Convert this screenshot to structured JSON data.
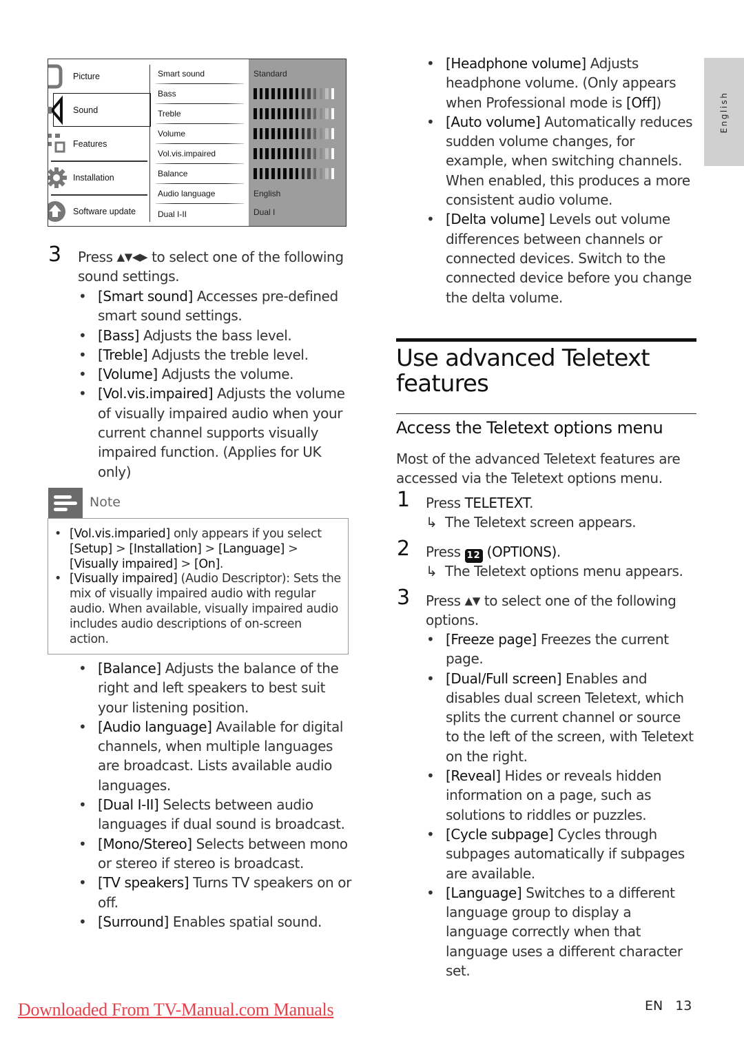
{
  "tv_menu": {
    "left_items": [
      {
        "label": "Picture",
        "icon": "tv-screen-icon"
      },
      {
        "label": "Sound",
        "icon": "speaker-icon",
        "selected": true
      },
      {
        "label": "Features",
        "icon": "features-squares-icon"
      },
      {
        "label": "Installation",
        "icon": "gear-icon"
      },
      {
        "label": "Software update",
        "icon": "upload-arrow-icon"
      }
    ],
    "mid_items": [
      "Smart sound",
      "Bass",
      "Treble",
      "Volume",
      "Vol.vis.impaired",
      "Balance",
      "Audio language",
      "Dual I-II"
    ],
    "right_values": {
      "smart_sound": "Standard",
      "audio_language": "English",
      "dual": "Dual I"
    },
    "level_bars_count": 5
  },
  "left_col": {
    "step3": {
      "number": "3",
      "text_pre": "Press ",
      "arrows": "▲▼◀▶",
      "text_post": " to select one of the following sound settings."
    },
    "bullets_a": [
      {
        "term": "[Smart sound]",
        "desc": " Accesses pre-defined smart sound settings."
      },
      {
        "term": "[Bass]",
        "desc": " Adjusts the bass level."
      },
      {
        "term": "[Treble]",
        "desc": " Adjusts the treble level."
      },
      {
        "term": "[Volume]",
        "desc": " Adjusts the volume."
      },
      {
        "term": "[Vol.vis.impaired]",
        "desc": " Adjusts the volume of visually impaired audio when your current channel supports visually impaired function. (Applies for UK only)"
      }
    ],
    "note": {
      "label": "Note",
      "items": [
        {
          "parts": [
            {
              "t": "[Vol.vis.imparied]",
              "b": true
            },
            {
              "t": " only appears if you select ",
              "b": false
            },
            {
              "t": "[Setup]",
              "b": true
            },
            {
              "t": " > ",
              "b": false
            },
            {
              "t": "[Installation]",
              "b": true
            },
            {
              "t": " > ",
              "b": false
            },
            {
              "t": "[Language]",
              "b": true
            },
            {
              "t": " > ",
              "b": false
            },
            {
              "t": "[Visually impaired]",
              "b": true
            },
            {
              "t": " > ",
              "b": false
            },
            {
              "t": "[On]",
              "b": true
            },
            {
              "t": ".",
              "b": false
            }
          ]
        },
        {
          "parts": [
            {
              "t": "[Visually impaired]",
              "b": true
            },
            {
              "t": " (Audio Descriptor): Sets the mix of visually impaired audio with regular audio. When available, visually impaired audio includes audio descriptions of on-screen action.",
              "b": false
            }
          ]
        }
      ]
    },
    "bullets_b": [
      {
        "term": "[Balance]",
        "desc": " Adjusts the balance of the right and left speakers to best suit your listening position."
      },
      {
        "term": "[Audio language]",
        "desc": " Available for digital channels, when multiple languages are broadcast. Lists available audio languages."
      },
      {
        "term": "[Dual I-II]",
        "desc": " Selects between audio languages if dual sound is broadcast."
      },
      {
        "term": "[Mono/Stereo]",
        "desc": " Selects between mono or stereo if stereo is broadcast."
      },
      {
        "term": "[TV speakers]",
        "desc": " Turns TV speakers on or off."
      },
      {
        "term": "[Surround]",
        "desc": " Enables spatial sound."
      }
    ]
  },
  "right_col": {
    "bullets_top": [
      {
        "parts": [
          {
            "t": "[Headphone volume]",
            "b": true
          },
          {
            "t": " Adjusts headphone volume. (Only appears when Professional mode is ",
            "b": false
          },
          {
            "t": "[Off]",
            "b": true
          },
          {
            "t": ")",
            "b": false
          }
        ]
      },
      {
        "parts": [
          {
            "t": "[Auto volume]",
            "b": true
          },
          {
            "t": " Automatically reduces sudden volume changes, for example, when switching channels. When enabled, this produces a more consistent audio volume.",
            "b": false
          }
        ]
      },
      {
        "parts": [
          {
            "t": "[Delta volume]",
            "b": true
          },
          {
            "t": " Levels out volume differences between channels or connected devices. Switch to the connected device before you change the delta volume.",
            "b": false
          }
        ]
      }
    ],
    "section_title": "Use advanced Teletext features",
    "subsection_title": "Access the Teletext options menu",
    "intro": "Most of the advanced Teletext features are accessed via the Teletext options menu.",
    "steps": [
      {
        "number": "1",
        "pre": "Press ",
        "key": "TELETEXT",
        "post": ".",
        "result": "The Teletext screen appears."
      },
      {
        "number": "2",
        "pre": "Press ",
        "icon_label": "12",
        "key": "(OPTIONS)",
        "post": ".",
        "result": "The Teletext options menu appears."
      },
      {
        "number": "3",
        "pre": "Press ",
        "arrows": "▲▼",
        "post": " to select one of the following options."
      }
    ],
    "options": [
      {
        "term": "[Freeze page]",
        "desc": " Freezes the current page."
      },
      {
        "term": "[Dual/Full screen]",
        "desc": " Enables and disables dual screen Teletext, which splits the current channel or source to the left of the screen, with Teletext on the right."
      },
      {
        "term": "[Reveal]",
        "desc": " Hides or reveals hidden information on a page, such as solutions to riddles or puzzles."
      },
      {
        "term": "[Cycle subpage]",
        "desc": " Cycles through subpages automatically if subpages are available."
      },
      {
        "term": "[Language]",
        "desc": " Switches to a different language group to display a language correctly when that language uses a different character set."
      }
    ],
    "result_arrow": "↳"
  },
  "side_tab": {
    "label": "English"
  },
  "footer": {
    "link_text": "Downloaded From TV-Manual.com Manuals",
    "lang": "EN",
    "page": "13"
  },
  "colors": {
    "link": "#e8404a",
    "menu_panel": "#9d9d9d",
    "note_header": "#6b6b6b",
    "side_tab": "#d0d0d0"
  }
}
